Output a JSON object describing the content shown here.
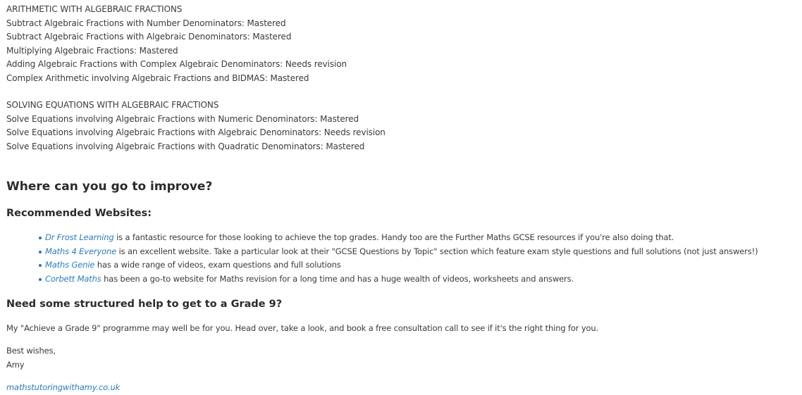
{
  "section_arithmetic": {
    "heading": "ARITHMETIC WITH ALGEBRAIC FRACTIONS",
    "items": [
      "Subtract Algebraic Fractions with Number Denominators: Mastered",
      "Subtract Algebraic Fractions with Algebraic Denominators: Mastered",
      "Multiplying Algebraic Fractions: Mastered",
      "Adding Algebraic Fractions with Complex Algebraic Denominators: Needs revision",
      "Complex Arithmetic involving Algebraic Fractions and BIDMAS: Mastered"
    ]
  },
  "section_equations": {
    "heading": "SOLVING EQUATIONS WITH ALGEBRAIC FRACTIONS",
    "items": [
      "Solve Equations involving Algebraic Fractions with Numeric Denominators: Mastered",
      "Solve Equations involving Algebraic Fractions with Algebraic Denominators: Needs revision",
      "Solve Equations involving Algebraic Fractions with Quadratic Denominators: Mastered"
    ]
  },
  "improve_heading": "Where can you go to improve?",
  "websites_heading": "Recommended Websites:",
  "websites": [
    {
      "link": "Dr Frost Learning",
      "text": " is a fantastic resource for those looking to achieve the top grades. Handy too are the Further Maths GCSE resources if you're also doing that."
    },
    {
      "link": "Maths 4 Everyone",
      "text": " is an excellent website. Take a particular look at their \"GCSE Questions by Topic\" section which feature exam style questions and full solutions (not just answers!)"
    },
    {
      "link": "Maths Genie",
      "text": " has a wide range of videos, exam questions and full solutions"
    },
    {
      "link": "Corbett Maths",
      "text": " has been a go-to website for Maths revision for a long time and has a huge wealth of videos, worksheets and answers."
    }
  ],
  "grade9_heading": "Need some structured help to get to a Grade 9?",
  "grade9_text": "My \"Achieve a Grade 9\" programme may well be for you. Head over, take a look, and book a free consultation call to see if it's the right thing for you.",
  "sign_off": "Best wishes,",
  "sign_name": "Amy",
  "site_link": "mathstutoringwithamy.co.uk",
  "colors": {
    "text": "#3a3a3a",
    "heading": "#2b2b2b",
    "link": "#2b7bbf"
  }
}
